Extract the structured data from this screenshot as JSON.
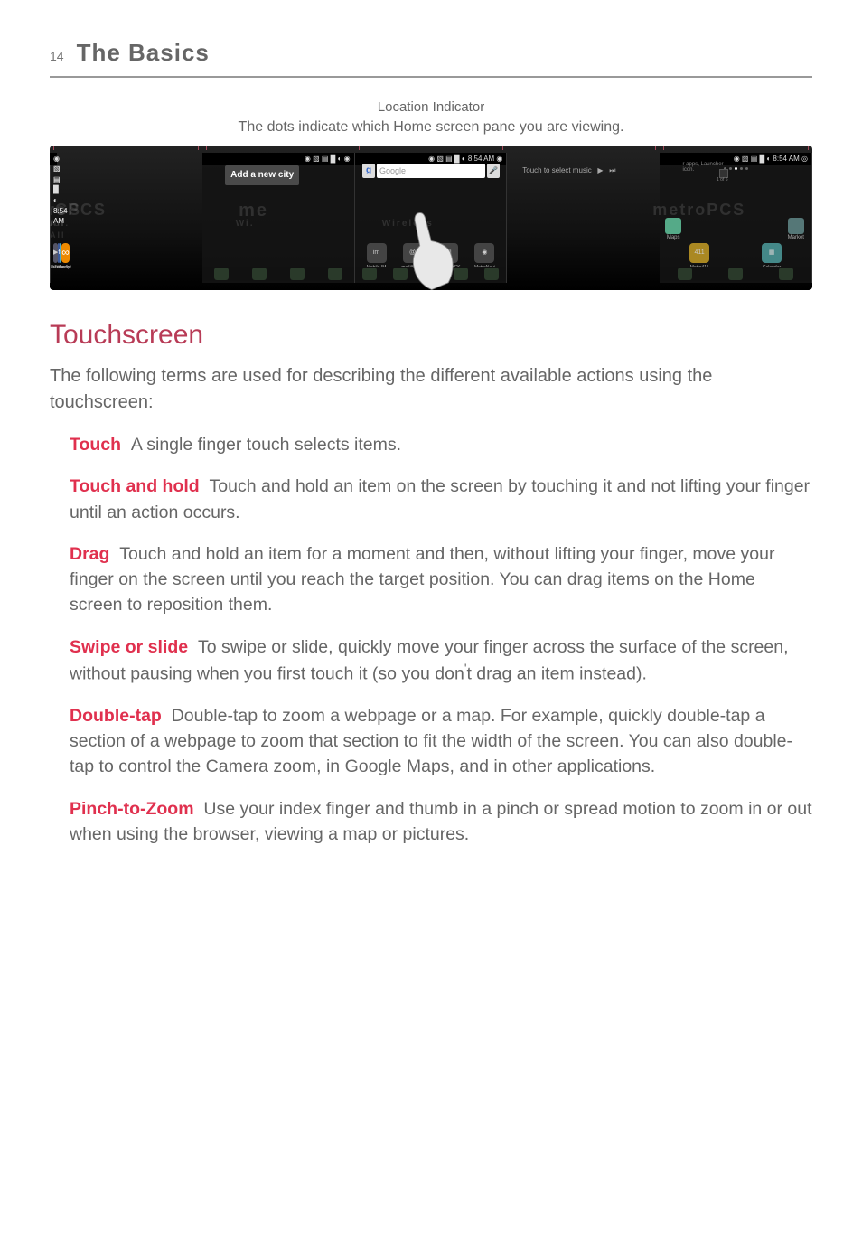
{
  "page_number": "14",
  "page_title": "The Basics",
  "indicator": {
    "title": "Location Indicator",
    "subtitle": "The dots indicate which Home screen pane you are viewing."
  },
  "screens": {
    "status_time": "8:54 AM",
    "add_city_label": "Add a new city",
    "search_placeholder": "Google",
    "touch_select": "Touch to select music",
    "apps_hint": "r apps, Launcher icon.",
    "wireless_text": "Wireless",
    "me_text": "me",
    "metro_text": "metroPCS",
    "tropcs_text": "troPCS",
    "for_all": "for All",
    "all_text": "All.",
    "cs_text": "CS",
    "row2_apps": [
      "Mobile IM",
      "mail@metr",
      "metroBACK",
      "MetroNavi"
    ],
    "row3_apps": [
      "Metro411",
      "Calendar"
    ],
    "row3_icons": [
      "Maps",
      "Market"
    ],
    "row4_apps": [
      "YouTube",
      "Facebook",
      "Twitter for",
      "Loopt"
    ]
  },
  "section_title": "Touchscreen",
  "lead": "The following terms are used for describing the different available actions using the touchscreen:",
  "terms": {
    "touch": {
      "label": "Touch",
      "desc": "A single finger touch selects items."
    },
    "touch_hold": {
      "label": "Touch and hold",
      "desc": "Touch and hold an item on the screen by touching it and not lifting your finger until an action occurs."
    },
    "drag": {
      "label": "Drag",
      "desc": "Touch and hold an item for a moment and then, without lifting your finger, move your finger on the screen until you reach the target position. You can drag items on the Home screen to reposition them."
    },
    "swipe": {
      "label": "Swipe or slide",
      "desc_a": "To swipe or slide, quickly move your finger across the surface of the screen, without pausing when you first touch it (so you don",
      "desc_b": "t drag an item instead)."
    },
    "double_tap": {
      "label": "Double-tap",
      "desc": "Double-tap to zoom a webpage or a map. For example, quickly double-tap a section of a webpage to zoom that section to fit the width of the screen. You can also double-tap to control the Camera zoom, in Google Maps, and in other applications."
    },
    "pinch": {
      "label": "Pinch-to-Zoom",
      "desc": "Use your index finger and thumb in a pinch or spread motion to zoom in or out when using the browser, viewing a map or pictures."
    }
  }
}
